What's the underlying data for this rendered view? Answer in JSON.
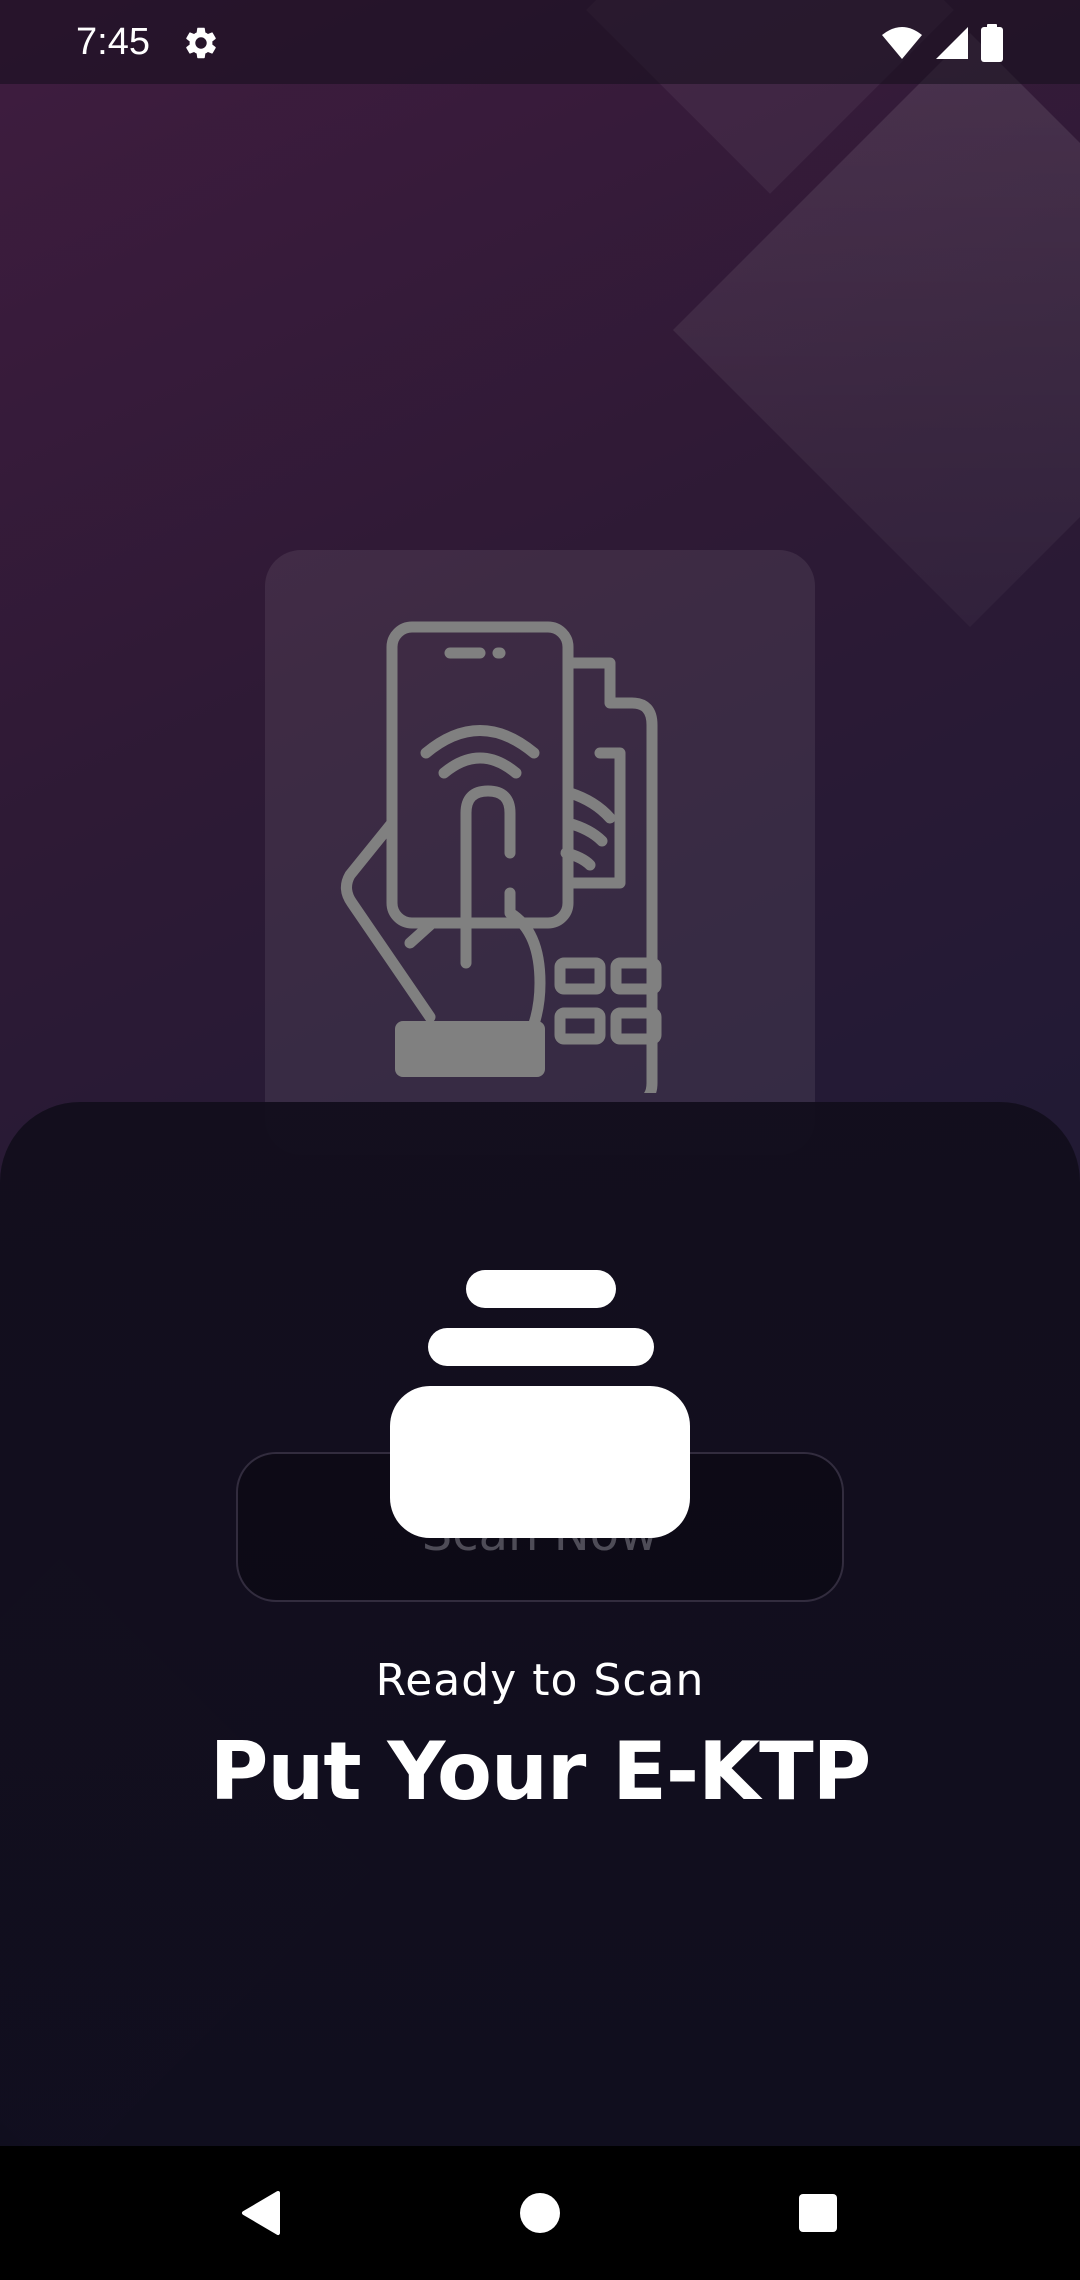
{
  "status_bar": {
    "time": "7:45",
    "icons": [
      "gear-icon",
      "wifi-icon",
      "cellular-signal-icon",
      "battery-icon"
    ]
  },
  "illustration": {
    "icon": "nfc-phone-payment-icon"
  },
  "sheet": {
    "nfc_icon": "nfc-scan-glyph-icon",
    "scan_button_label": "Scan Now",
    "ready_text": "Ready to Scan",
    "headline": "Put Your E-KTP"
  },
  "nav_bar": {
    "icons": [
      "back-icon",
      "home-icon",
      "recents-icon"
    ]
  },
  "colors": {
    "background_top": "#3f1c3f",
    "background_bottom": "#141225",
    "sheet": "#120e1c",
    "text": "#ffffff",
    "illustration_stroke": "#808080",
    "nav_bar": "#000000"
  }
}
